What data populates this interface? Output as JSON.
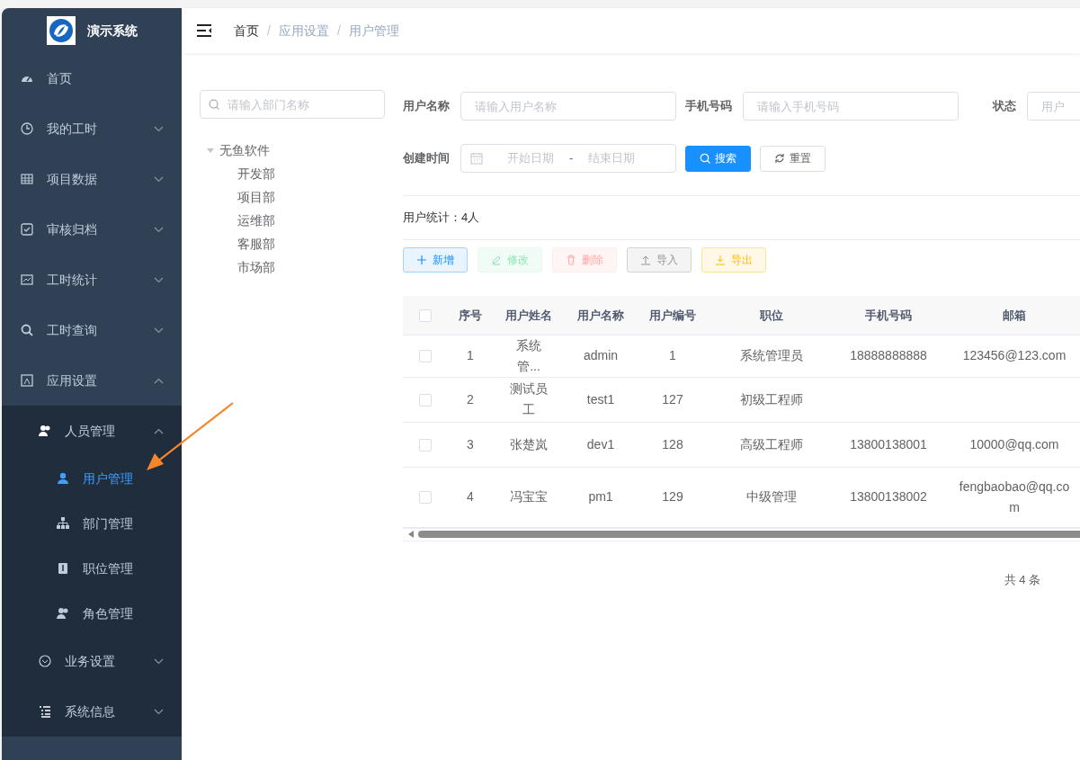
{
  "app": {
    "title": "演示系统"
  },
  "sidebar": {
    "items": [
      {
        "label": "首页"
      },
      {
        "label": "我的工时",
        "expanded": false
      },
      {
        "label": "项目数据",
        "expanded": false
      },
      {
        "label": "审核归档",
        "expanded": false
      },
      {
        "label": "工时统计",
        "expanded": false
      },
      {
        "label": "工时查询",
        "expanded": false
      },
      {
        "label": "应用设置",
        "expanded": true,
        "children": [
          {
            "label": "人员管理",
            "expanded": true,
            "children": [
              {
                "label": "用户管理",
                "selected": true
              },
              {
                "label": "部门管理",
                "selected": false
              },
              {
                "label": "职位管理",
                "selected": false
              },
              {
                "label": "角色管理",
                "selected": false
              }
            ]
          },
          {
            "label": "业务设置",
            "expanded": false
          },
          {
            "label": "系统信息",
            "expanded": false
          }
        ]
      }
    ]
  },
  "breadcrumb": {
    "separator": "/",
    "items": [
      "首页",
      "应用设置",
      "用户管理"
    ]
  },
  "dept_tree": {
    "search_placeholder": "请输入部门名称",
    "root": {
      "label": "无鱼软件",
      "expanded": true,
      "children": [
        {
          "label": "开发部"
        },
        {
          "label": "项目部"
        },
        {
          "label": "运维部"
        },
        {
          "label": "客服部"
        },
        {
          "label": "市场部"
        }
      ]
    }
  },
  "filters": [
    {
      "label": "用户名称",
      "placeholder": "请输入用户名称"
    },
    {
      "label": "手机号码",
      "placeholder": "请输入手机号码"
    },
    {
      "label": "状态",
      "placeholder": "用户"
    }
  ],
  "date_range": {
    "label": "创建时间",
    "start_placeholder": "开始日期",
    "separator": "-",
    "end_placeholder": "结束日期"
  },
  "filter_buttons": [
    {
      "label": "搜索",
      "kind": "search"
    },
    {
      "label": "重置",
      "kind": "reset"
    }
  ],
  "stats": "用户统计：4人",
  "toolbar": [
    {
      "label": "新增",
      "kind": "add",
      "disabled": false
    },
    {
      "label": "修改",
      "kind": "edit",
      "disabled": true
    },
    {
      "label": "删除",
      "kind": "delete",
      "disabled": true
    },
    {
      "label": "导入",
      "kind": "import",
      "disabled": false
    },
    {
      "label": "导出",
      "kind": "export",
      "disabled": false
    }
  ],
  "table": {
    "header_checked": false,
    "columns": [
      "序号",
      "用户姓名",
      "用户名称",
      "用户编号",
      "职位",
      "手机号码",
      "邮箱"
    ],
    "rows": [
      {
        "checked": false,
        "cells": [
          "1",
          "系统管...",
          "admin",
          "1",
          "系统管理员",
          "18888888888",
          "123456@123.com"
        ]
      },
      {
        "checked": false,
        "cells": [
          "2",
          "测试员工",
          "test1",
          "127",
          "初级工程师",
          "",
          ""
        ]
      },
      {
        "checked": false,
        "cells": [
          "3",
          "张楚岚",
          "dev1",
          "128",
          "高级工程师",
          "13800138001",
          "10000@qq.com"
        ]
      },
      {
        "checked": false,
        "cells": [
          "4",
          "冯宝宝",
          "pm1",
          "129",
          "中级管理",
          "13800138002",
          "fengbaobao@qq.com"
        ]
      }
    ]
  },
  "pagination": {
    "total": "共 4 条"
  }
}
